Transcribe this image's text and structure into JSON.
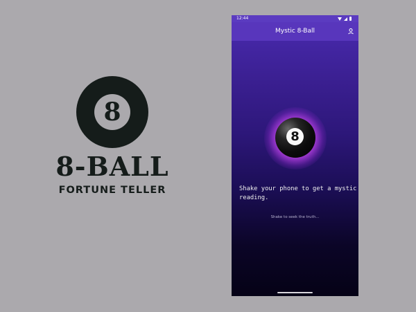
{
  "branding": {
    "logo_numeral": "8",
    "title": "8-BALL",
    "subtitle": "FORTUNE TELLER"
  },
  "status_bar": {
    "time": "12:44",
    "icons": [
      "wifi-icon",
      "signal-icon",
      "battery-icon"
    ]
  },
  "app_bar": {
    "title": "Mystic 8-Ball",
    "action_icon": "settings-icon"
  },
  "ball": {
    "numeral": "8"
  },
  "main": {
    "reading_text": "Shake your phone to get a mystic reading.",
    "hint_text": "Shake to seek the truth..."
  },
  "colors": {
    "canvas_background": "#aba9ad",
    "app_bar": "#5836bc",
    "glow": "#d66cff",
    "text_light": "#f0f0f0"
  }
}
